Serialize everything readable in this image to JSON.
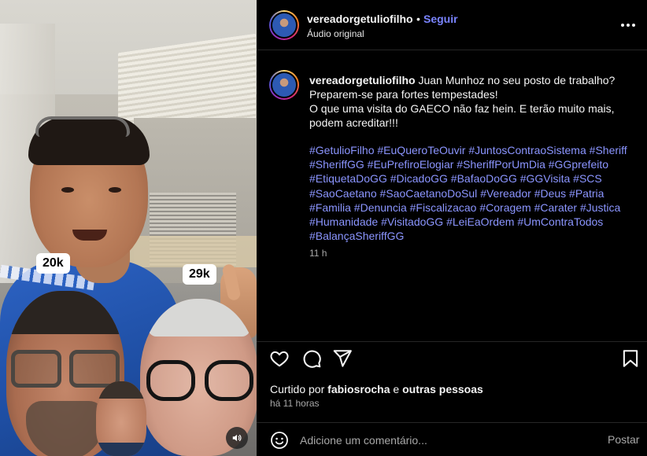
{
  "media": {
    "stickers": [
      {
        "count": "20k"
      },
      {
        "count": "29k"
      }
    ],
    "mute_icon": "speaker-icon"
  },
  "header": {
    "username": "vereadorgetuliofilho",
    "separator": "•",
    "follow_label": "Seguir",
    "audio_label": "Áudio original",
    "more_icon": "more-options-icon"
  },
  "caption": {
    "username": "vereadorgetuliofilho",
    "lines": [
      "Juan Munhoz no seu posto de trabalho?",
      "Preparem-se para fortes tempestades!",
      "O que uma visita do GAECO não faz hein. E terão muito mais, podem acreditar!!!"
    ],
    "hashtags": [
      "#GetulioFilho",
      "#EuQueroTeOuvir",
      "#JuntosContraoSistema",
      "#Sheriff",
      "#SheriffGG",
      "#EuPrefiroElogiar",
      "#SheriffPorUmDia",
      "#GGprefeito",
      "#EtiquetaDoGG",
      "#DicadoGG",
      "#BafaoDoGG",
      "#GGVisita",
      "#SCS",
      "#SaoCaetano",
      "#SaoCaetanoDoSul",
      "#Vereador",
      "#Deus",
      "#Patria",
      "#Familia",
      "#Denuncia",
      "#Fiscalizacao",
      "#Coragem",
      "#Carater",
      "#Justica",
      "#Humanidade",
      "#VisitadoGG",
      "#LeiEaOrdem",
      "#UmContraTodos",
      "#BalançaSheriffGG"
    ],
    "time_ago": "11 h"
  },
  "actions": {
    "liked_prefix": "Curtido por",
    "liked_user": "fabiosrocha",
    "liked_conj": "e",
    "liked_others": "outras pessoas",
    "posted_ago": "há 11 horas"
  },
  "comment": {
    "placeholder": "Adicione um comentário...",
    "post_label": "Postar"
  },
  "colors": {
    "background": "#000000",
    "link_blue": "#7a84ff",
    "hashtag_blue": "#8b95ff",
    "muted": "#a8a8a8",
    "divider": "#262626"
  }
}
